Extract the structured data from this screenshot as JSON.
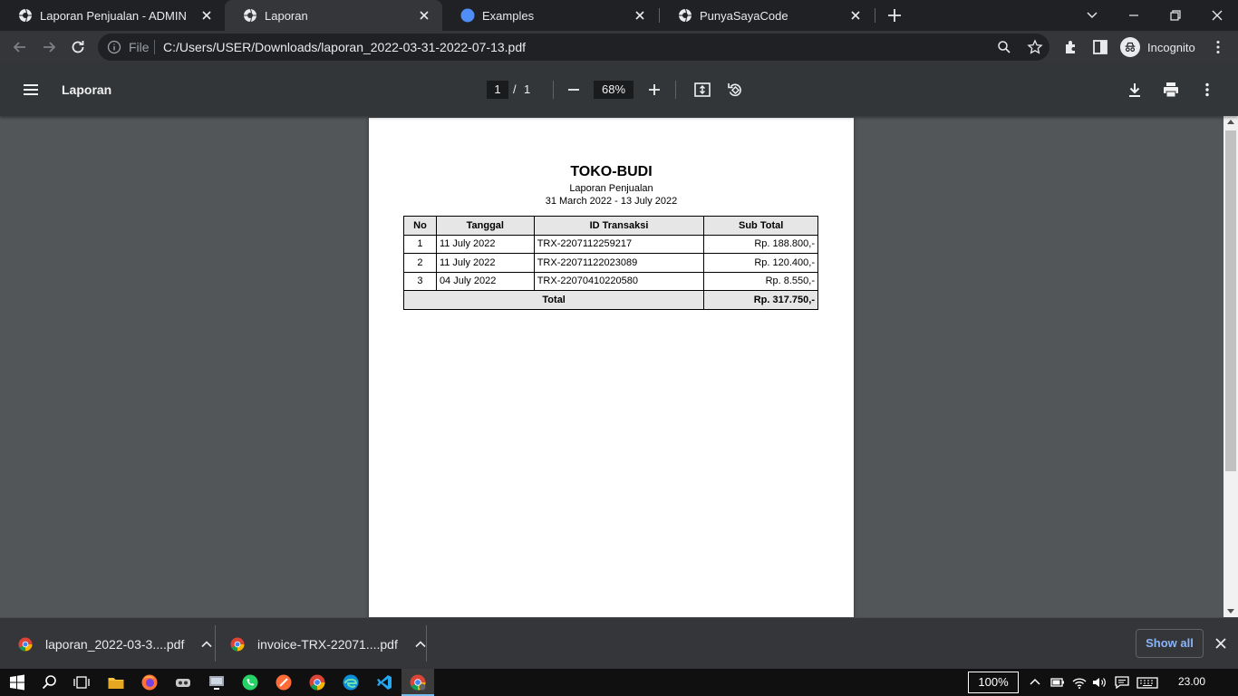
{
  "browser": {
    "tabs": [
      {
        "label": "Laporan Penjualan - ADMIN",
        "active": false,
        "favicon": "globe-icon"
      },
      {
        "label": "Laporan",
        "active": true,
        "favicon": "globe-icon"
      },
      {
        "label": "Examples",
        "active": false,
        "favicon": "compass-icon"
      },
      {
        "label": "PunyaSayaCode",
        "active": false,
        "favicon": "globe-icon"
      }
    ],
    "address": {
      "scheme": "File",
      "url": "C:/Users/USER/Downloads/laporan_2022-03-31-2022-07-13.pdf"
    },
    "profile_label": "Incognito"
  },
  "pdf_viewer": {
    "title": "Laporan",
    "current_page": "1",
    "page_separator": "/",
    "page_count": "1",
    "zoom": "68%"
  },
  "document": {
    "title": "TOKO-BUDI",
    "subtitle": "Laporan Penjualan",
    "date_range": "31 March 2022 - 13 July 2022",
    "columns": [
      "No",
      "Tanggal",
      "ID Transaksi",
      "Sub Total"
    ],
    "rows": [
      {
        "no": "1",
        "tanggal": "11 July 2022",
        "id": "TRX-2207112259217",
        "subtotal": "Rp. 188.800,-"
      },
      {
        "no": "2",
        "tanggal": "11 July 2022",
        "id": "TRX-22071122023089",
        "subtotal": "Rp. 120.400,-"
      },
      {
        "no": "3",
        "tanggal": "04 July 2022",
        "id": "TRX-22070410220580",
        "subtotal": "Rp. 8.550,-"
      }
    ],
    "total_label": "Total",
    "total_value": "Rp. 317.750,-"
  },
  "downloads": {
    "items": [
      {
        "name": "laporan_2022-03-3....pdf"
      },
      {
        "name": "invoice-TRX-22071....pdf"
      }
    ],
    "show_all_label": "Show all"
  },
  "taskbar": {
    "zoom": "100%",
    "clock": "23.00"
  },
  "colors": {
    "viewer_bg": "#525659",
    "pdf_toolbar": "#323639",
    "link_accent": "#8ab4f8"
  }
}
